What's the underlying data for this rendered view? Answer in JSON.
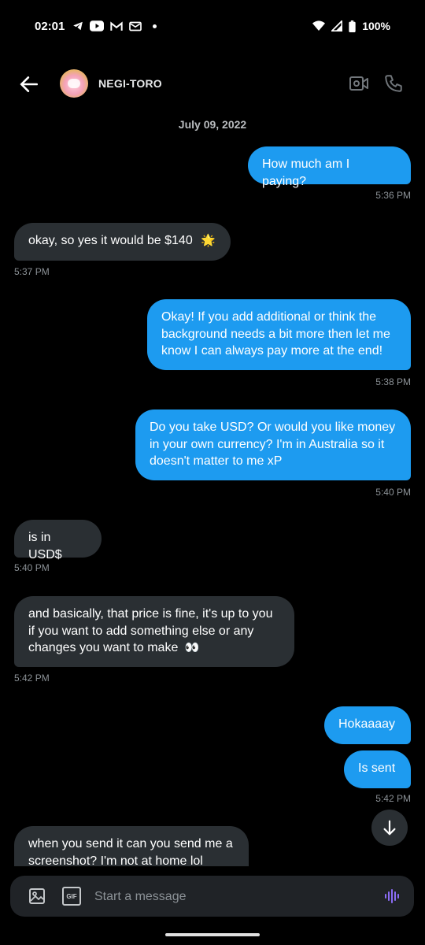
{
  "status_bar": {
    "time": "02:01",
    "battery": "100%",
    "notification_icons": [
      "telegram-icon",
      "youtube-icon",
      "gmail-icon",
      "mail-icon",
      "dot-icon"
    ],
    "system_icons": [
      "wifi-icon",
      "signal-icon",
      "battery-icon"
    ]
  },
  "header": {
    "contact_name": "NEGI-TORO"
  },
  "conversation": {
    "date": "July 09, 2022",
    "messages": [
      {
        "direction": "sent",
        "text": "How much am I paying?",
        "time": "5:36 PM"
      },
      {
        "direction": "received",
        "text": "okay, so yes it would be $140",
        "emoji": "🌟",
        "time": "5:37 PM"
      },
      {
        "direction": "sent",
        "text": "Okay! If you add additional or think the background needs a bit more then let me know I can always pay more at the end!",
        "time": "5:38 PM"
      },
      {
        "direction": "sent",
        "text": "Do you take USD? Or would you like money in your own currency? I'm in Australia so it doesn't matter to me xP",
        "time": "5:40 PM"
      },
      {
        "direction": "received",
        "text": "is in USD$",
        "time": "5:40 PM"
      },
      {
        "direction": "received",
        "text": "and basically, that price is fine, it's up to you if you want to add something else or any changes you want to make",
        "emoji": "👀",
        "time": "5:42 PM"
      },
      {
        "direction": "sent",
        "text": "Hokaaaay",
        "time": ""
      },
      {
        "direction": "sent",
        "text": "Is sent",
        "time": "5:42 PM"
      },
      {
        "direction": "received",
        "text": "when you send it can you send me a screenshot? I'm not at home lol",
        "time": ""
      }
    ]
  },
  "composer": {
    "placeholder": "Start a message",
    "gif_label": "GIF"
  },
  "colors": {
    "sent_bubble": "#1d9bf0",
    "received_bubble": "#2a2f33",
    "voice_accent": "#8b6cf6"
  }
}
